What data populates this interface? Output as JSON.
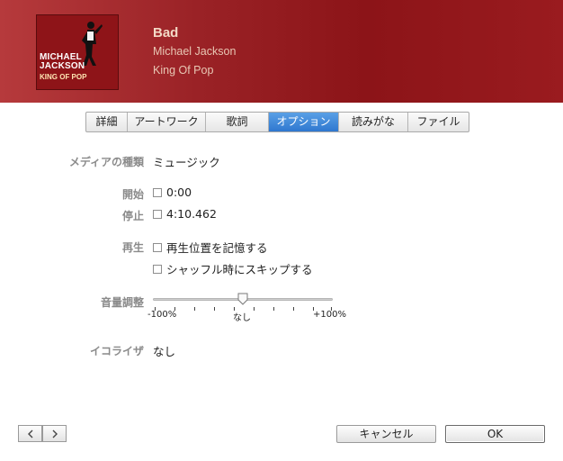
{
  "song": {
    "title": "Bad",
    "artist": "Michael Jackson",
    "album": "King Of Pop"
  },
  "artwork": {
    "text_line1": "MICHAEL",
    "text_line2": "JACKSON",
    "text_line3": "KING OF POP"
  },
  "tabs": [
    {
      "label": "詳細",
      "active": false
    },
    {
      "label": "アートワーク",
      "active": false
    },
    {
      "label": "歌詞",
      "active": false
    },
    {
      "label": "オプション",
      "active": true
    },
    {
      "label": "読みがな",
      "active": false
    },
    {
      "label": "ファイル",
      "active": false
    }
  ],
  "options": {
    "media_kind_label": "メディアの種類",
    "media_kind_value": "ミュージック",
    "start_label": "開始",
    "start_value": "0:00",
    "start_checked": false,
    "stop_label": "停止",
    "stop_value": "4:10.462",
    "stop_checked": false,
    "playback_label": "再生",
    "remember_position": "再生位置を記憶する",
    "remember_checked": false,
    "skip_shuffle": "シャッフル時にスキップする",
    "skip_checked": false,
    "volume_label": "音量調整",
    "volume_min": "-100%",
    "volume_mid": "なし",
    "volume_max": "+100%",
    "volume_level": 0.5,
    "eq_label": "イコライザ",
    "eq_value": "なし"
  },
  "footer": {
    "prev_icon": "chevron-left-icon",
    "next_icon": "chevron-right-icon",
    "cancel_label": "キャンセル",
    "ok_label": "OK"
  },
  "colors": {
    "header_red": "#9a2226",
    "tab_active": "#2f77cf",
    "label_gray": "#8a8a8a"
  }
}
